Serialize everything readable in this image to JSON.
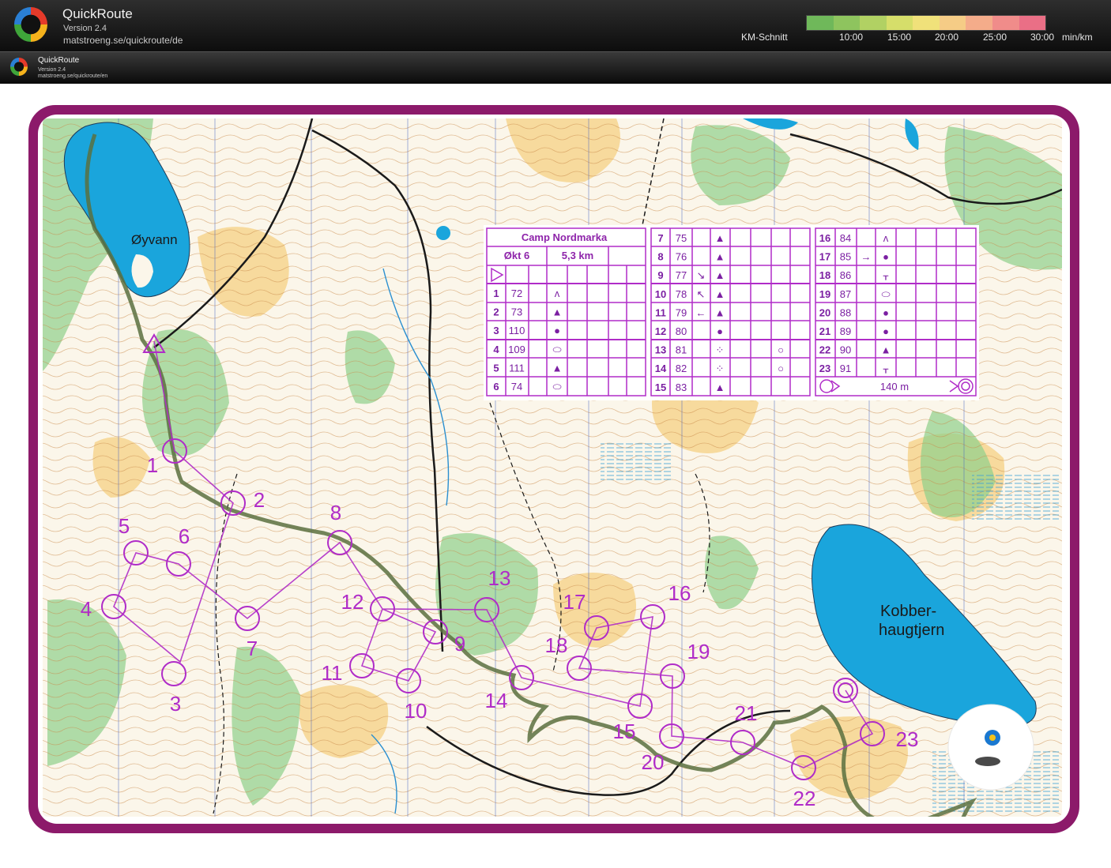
{
  "header": {
    "app_name": "QuickRoute",
    "version": "Version 2.4",
    "url": "matstroeng.se/quickroute/de",
    "pace_label": "KM-Schnitt",
    "pace_ticks": [
      "10:00",
      "15:00",
      "20:00",
      "25:00",
      "30:00"
    ],
    "pace_unit": "min/km",
    "pace_colors": [
      "#6fb85a",
      "#8ec45e",
      "#b1d163",
      "#d6de6a",
      "#f0e17a",
      "#f5cc86",
      "#f4ac8a",
      "#f08c8a",
      "#ea6f86"
    ]
  },
  "subheader": {
    "app_name": "QuickRoute",
    "version": "Version 2.4",
    "url": "matstroeng.se/quickroute/en"
  },
  "map": {
    "border_color": "#8c1a6a",
    "course_color": "#b02cc8",
    "route_color": "#5a7040",
    "water_color": "#1aa5dc",
    "lake_labels": [
      "Øyvann",
      "Kobber-",
      "haugtjern"
    ],
    "controls": [
      {
        "n": "1"
      },
      {
        "n": "2"
      },
      {
        "n": "3"
      },
      {
        "n": "4"
      },
      {
        "n": "5"
      },
      {
        "n": "6"
      },
      {
        "n": "7"
      },
      {
        "n": "8"
      },
      {
        "n": "9"
      },
      {
        "n": "10"
      },
      {
        "n": "11"
      },
      {
        "n": "12"
      },
      {
        "n": "13"
      },
      {
        "n": "14"
      },
      {
        "n": "15"
      },
      {
        "n": "16"
      },
      {
        "n": "17"
      },
      {
        "n": "18"
      },
      {
        "n": "19"
      },
      {
        "n": "20"
      },
      {
        "n": "21"
      },
      {
        "n": "22"
      },
      {
        "n": "23"
      }
    ]
  },
  "description_sheet": {
    "event": "Camp Nordmarka",
    "session": "Økt 6",
    "length": "5,3 km",
    "rows_col1": [
      {
        "n": "1",
        "code": "72",
        "sym": "ʌ"
      },
      {
        "n": "2",
        "code": "73",
        "sym": "▲"
      },
      {
        "n": "3",
        "code": "110",
        "sym": "●"
      },
      {
        "n": "4",
        "code": "109",
        "sym": "⬭"
      },
      {
        "n": "5",
        "code": "111",
        "sym": "▲"
      },
      {
        "n": "6",
        "code": "74",
        "sym": "⬭"
      }
    ],
    "rows_col2": [
      {
        "n": "7",
        "code": "75",
        "dir": "",
        "sym": "▲",
        "extra": ""
      },
      {
        "n": "8",
        "code": "76",
        "dir": "",
        "sym": "▲",
        "extra": ""
      },
      {
        "n": "9",
        "code": "77",
        "dir": "↘",
        "sym": "▲",
        "extra": ""
      },
      {
        "n": "10",
        "code": "78",
        "dir": "↖",
        "sym": "▲",
        "extra": ""
      },
      {
        "n": "11",
        "code": "79",
        "dir": "←",
        "sym": "▲",
        "extra": ""
      },
      {
        "n": "12",
        "code": "80",
        "dir": "",
        "sym": "●",
        "extra": ""
      },
      {
        "n": "13",
        "code": "81",
        "dir": "",
        "sym": "⁘",
        "extra": "○"
      },
      {
        "n": "14",
        "code": "82",
        "dir": "",
        "sym": "⁘",
        "extra": "○"
      },
      {
        "n": "15",
        "code": "83",
        "dir": "",
        "sym": "▲",
        "extra": ""
      }
    ],
    "rows_col3": [
      {
        "n": "16",
        "code": "84",
        "dir": "",
        "sym": "ʌ"
      },
      {
        "n": "17",
        "code": "85",
        "dir": "→",
        "sym": "●"
      },
      {
        "n": "18",
        "code": "86",
        "dir": "",
        "sym": "ᚁ"
      },
      {
        "n": "19",
        "code": "87",
        "dir": "",
        "sym": "⬭"
      },
      {
        "n": "20",
        "code": "88",
        "dir": "",
        "sym": "●"
      },
      {
        "n": "21",
        "code": "89",
        "dir": "",
        "sym": "●"
      },
      {
        "n": "22",
        "code": "90",
        "dir": "",
        "sym": "▲"
      },
      {
        "n": "23",
        "code": "91",
        "dir": "",
        "sym": "ᚁ"
      }
    ],
    "finish_distance": "140 m"
  }
}
